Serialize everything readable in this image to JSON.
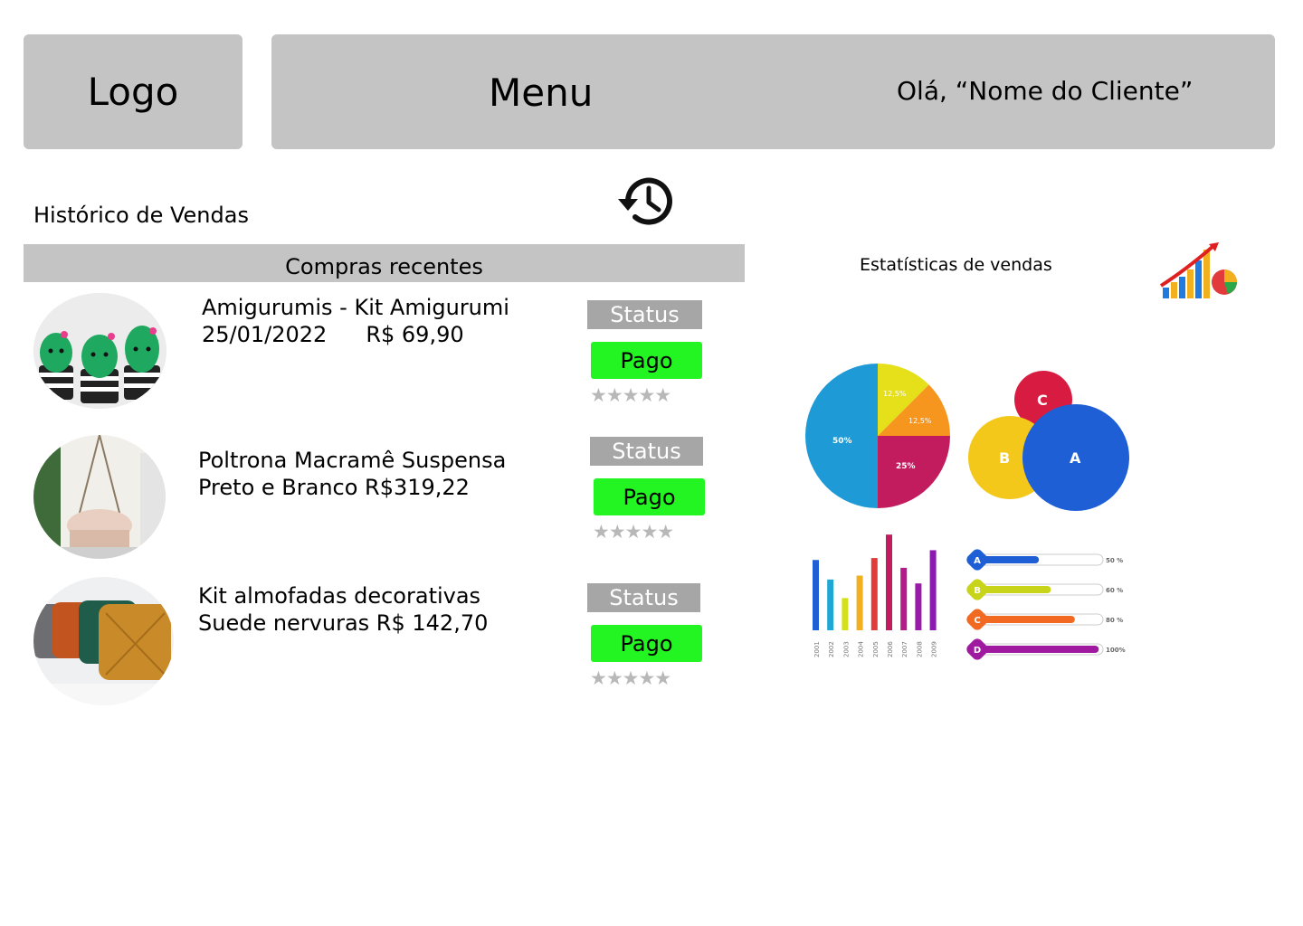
{
  "header": {
    "logo": "Logo",
    "menu": "Menu",
    "greeting": "Olá, “Nome do Cliente”"
  },
  "history": {
    "title": "Histórico de Vendas",
    "icon": "history-icon"
  },
  "recent": {
    "title": "Compras recentes",
    "items": [
      {
        "line1": "Amigurumis - Kit Amigurumi",
        "line2_date": "25/01/2022",
        "line2_price": "R$ 69,90",
        "status_label": "Status",
        "status": "Pago",
        "rating": "★★★★★",
        "image": "cactus-amigurumi-image"
      },
      {
        "line1": "Poltrona Macramê Suspensa",
        "line2": "Preto e Branco  R$319,22",
        "status_label": "Status",
        "status": "Pago",
        "rating": "★★★★★",
        "image": "macrame-chair-image"
      },
      {
        "line1": "Kit almofadas decorativas",
        "line2": "Suede nervuras R$ 142,70",
        "status_label": "Status",
        "status": "Pago",
        "rating": "★★★★★",
        "image": "cushions-image"
      }
    ]
  },
  "stats": {
    "title": "Estatísticas de vendas",
    "icon": "sales-chart-icon",
    "pie": {
      "labels": [
        "50%",
        "12,5%",
        "12,5%",
        "25%"
      ]
    },
    "venn": {
      "labels": [
        "C",
        "B",
        "A"
      ]
    },
    "bars": {
      "years": [
        "2001",
        "2002",
        "2003",
        "2004",
        "2005",
        "2006",
        "2007",
        "2008",
        "2009"
      ],
      "values": [
        0.72,
        0.52,
        0.33,
        0.56,
        0.74,
        0.98,
        0.64,
        0.48,
        0.82
      ]
    },
    "hbars": [
      {
        "label": "A",
        "value": 0.5,
        "text": "50 %",
        "color": "#1f5fd6"
      },
      {
        "label": "B",
        "value": 0.6,
        "text": "60 %",
        "color": "#c8d41a"
      },
      {
        "label": "C",
        "value": 0.8,
        "text": "80 %",
        "color": "#f26a21"
      },
      {
        "label": "D",
        "value": 1.0,
        "text": "100%",
        "color": "#a01aa0"
      }
    ]
  },
  "colors": {
    "panel": "#c4c4c4",
    "status": "#a6a6a6",
    "paid": "#22f522"
  }
}
